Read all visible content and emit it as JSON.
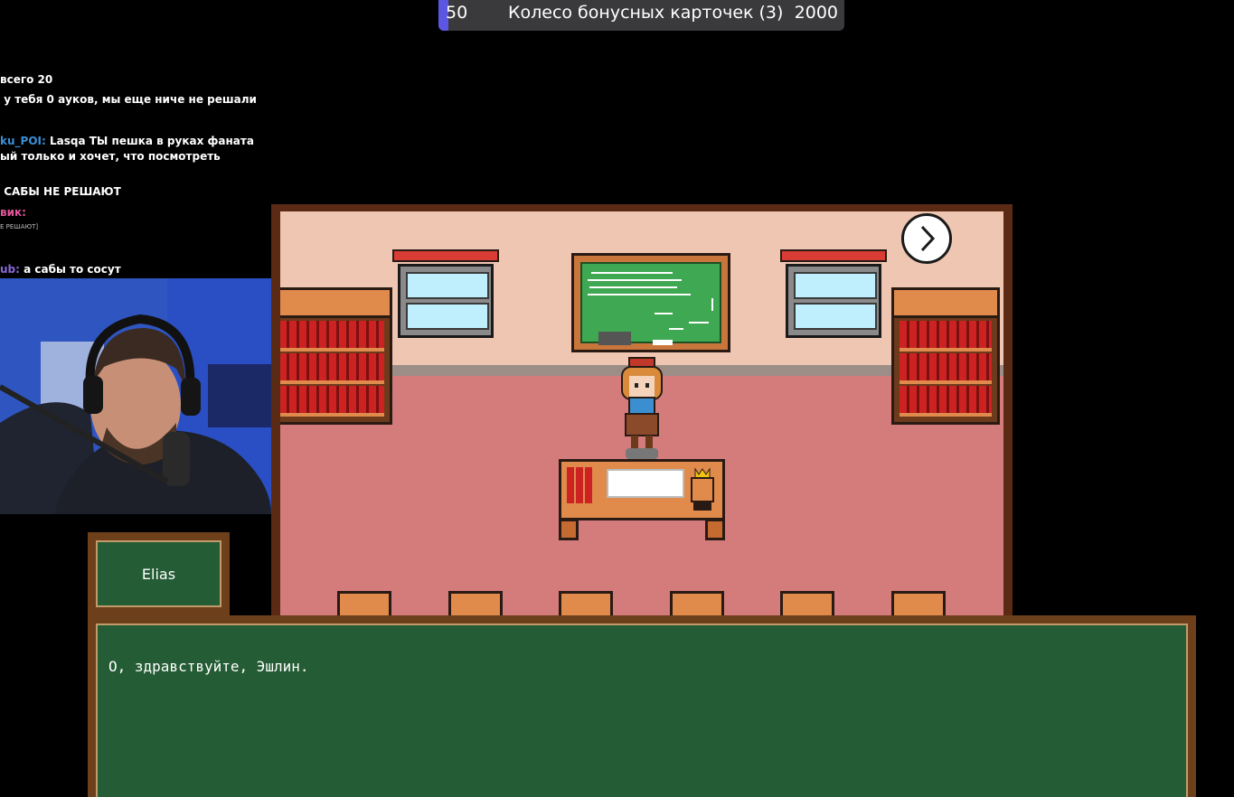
{
  "top_bar": {
    "start_value": "50",
    "title": "Колесо бонусных карточек  (3)",
    "end_value": "2000",
    "progress_fraction": 0.025,
    "fill_color": "#5b56e3"
  },
  "chat": {
    "messages": [
      {
        "text": "всего 20"
      },
      {
        "text": "у тебя 0 ауков, мы еще ниче не решали"
      },
      {
        "user": "ku_POI:",
        "user_color": "#3a8fd8",
        "mention": "Lasqa",
        "text": "ТЫ пешка в руках фаната"
      },
      {
        "text": "ый только и хочет, что посмотреть"
      },
      {
        "text": "САБЫ НЕ РЕШАЮТ"
      },
      {
        "user": "вик:",
        "user_color": "#e0569a"
      },
      {
        "text": "Е РЕШАЮТ]"
      },
      {
        "user": "ub:",
        "user_color": "#8a6ad8",
        "text": "а сабы то сосут"
      }
    ]
  },
  "dialogue": {
    "speaker": "Elias",
    "text": "О, здравствуйте, Эшлин."
  },
  "colors": {
    "panel_green": "#245c35",
    "panel_frame": "#6d3f1a"
  }
}
